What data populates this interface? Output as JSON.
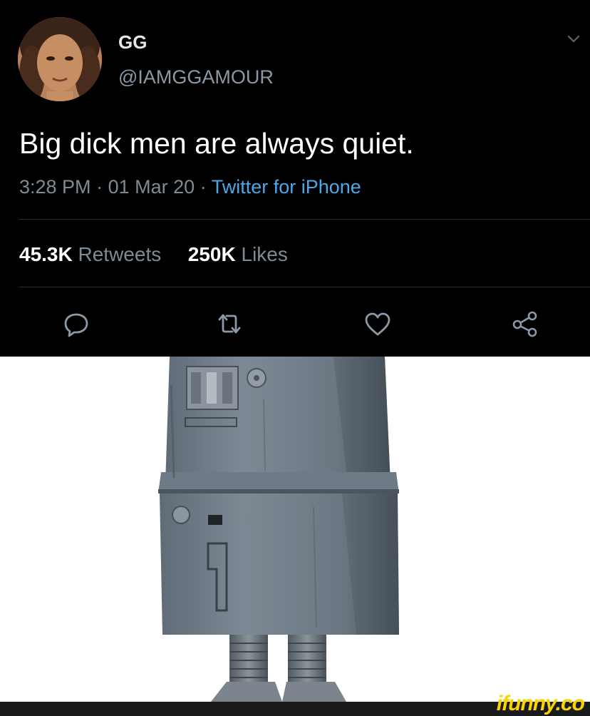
{
  "tweet": {
    "display_name": "GG",
    "handle": "@IAMGGAMOUR",
    "text": "Big dick men are always quiet.",
    "time": "3:28 PM",
    "separator": "·",
    "date": "01 Mar 20",
    "source": "Twitter for iPhone",
    "retweets_count": "45.3K",
    "retweets_label": "Retweets",
    "likes_count": "250K",
    "likes_label": "Likes"
  },
  "icons": {
    "menu": "chevron-down-icon",
    "reply": "reply-icon",
    "retweet": "retweet-icon",
    "like": "heart-icon",
    "share": "share-icon"
  },
  "colors": {
    "background": "#000000",
    "source_link": "#4aa8e8",
    "secondary_text": "#7e8a96",
    "watermark": "#f7d300"
  },
  "watermark": {
    "text": "ifunny.co"
  }
}
